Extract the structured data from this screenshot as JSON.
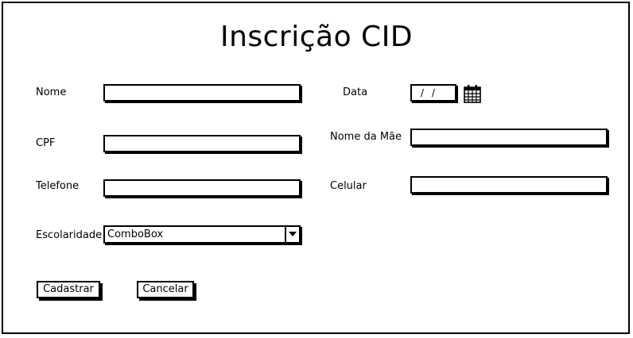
{
  "title": "Inscrição CID",
  "form": {
    "nome_label": "Nome",
    "nome_value": "",
    "cpf_label": "CPF",
    "cpf_value": "",
    "telefone_label": "Telefone",
    "telefone_value": "",
    "escolaridade_label": "Escolaridade",
    "escolaridade_value": "ComboBox",
    "data_label": "Data",
    "data_value": "/ /",
    "mae_label": "Nome da Mãe",
    "mae_value": "",
    "celular_label": "Celular",
    "celular_value": ""
  },
  "buttons": {
    "cadastrar": "Cadastrar",
    "cancelar": "Cancelar"
  },
  "icons": {
    "calendar": "calendar-icon",
    "dropdown": "chevron-down-icon"
  }
}
